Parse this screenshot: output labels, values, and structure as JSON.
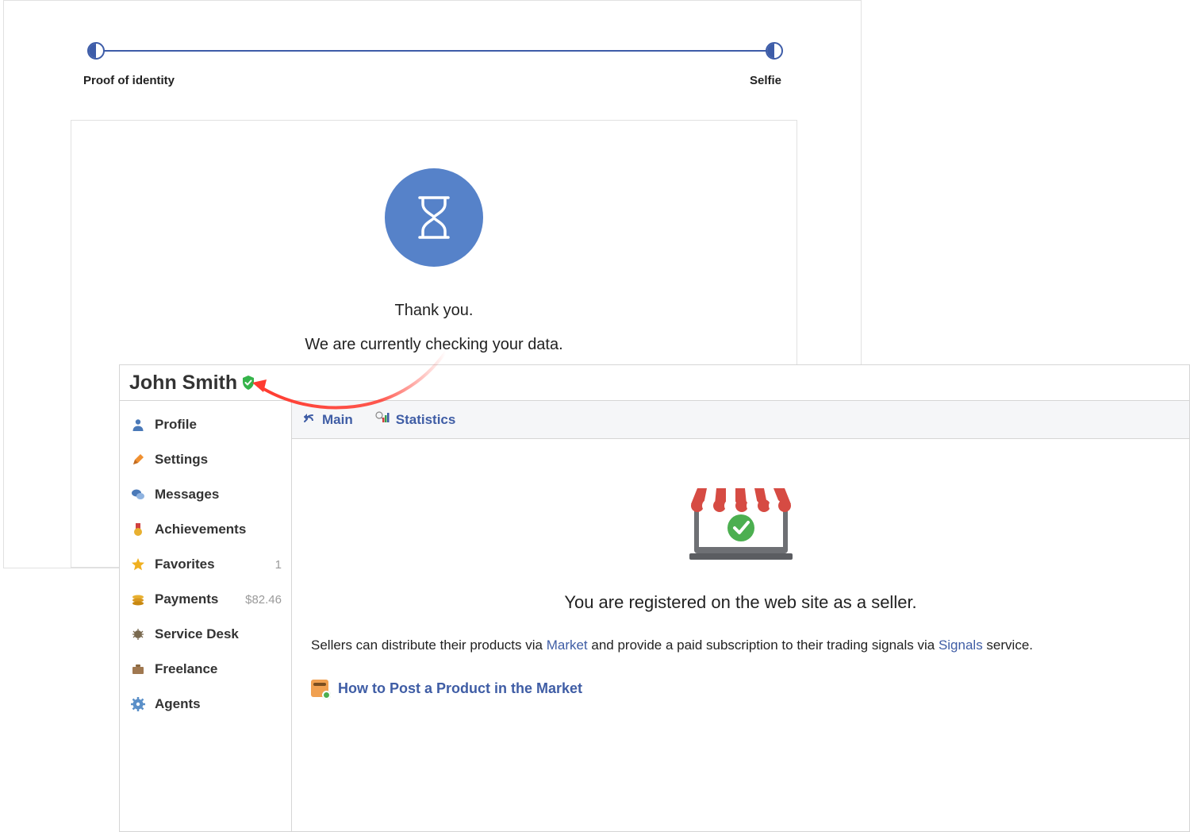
{
  "stepper": {
    "step1_label": "Proof of identity",
    "step2_label": "Selfie"
  },
  "pending": {
    "line1": "Thank you.",
    "line2": "We are currently checking your data."
  },
  "profile": {
    "username": "John Smith"
  },
  "sidebar": {
    "items": [
      {
        "label": "Profile",
        "badge": ""
      },
      {
        "label": "Settings",
        "badge": ""
      },
      {
        "label": "Messages",
        "badge": ""
      },
      {
        "label": "Achievements",
        "badge": ""
      },
      {
        "label": "Favorites",
        "badge": "1"
      },
      {
        "label": "Payments",
        "badge": "$82.46"
      },
      {
        "label": "Service Desk",
        "badge": ""
      },
      {
        "label": "Freelance",
        "badge": ""
      },
      {
        "label": "Agents",
        "badge": ""
      }
    ]
  },
  "tabs": {
    "main": "Main",
    "stats": "Statistics"
  },
  "main": {
    "heading": "You are registered on the web site as a seller.",
    "desc_prefix": "Sellers can distribute their products via ",
    "market_link": "Market",
    "desc_mid": " and provide a paid subscription to their trading signals via ",
    "signals_link": "Signals",
    "desc_suffix": " service.",
    "howto": "How to Post a Product in the Market"
  }
}
